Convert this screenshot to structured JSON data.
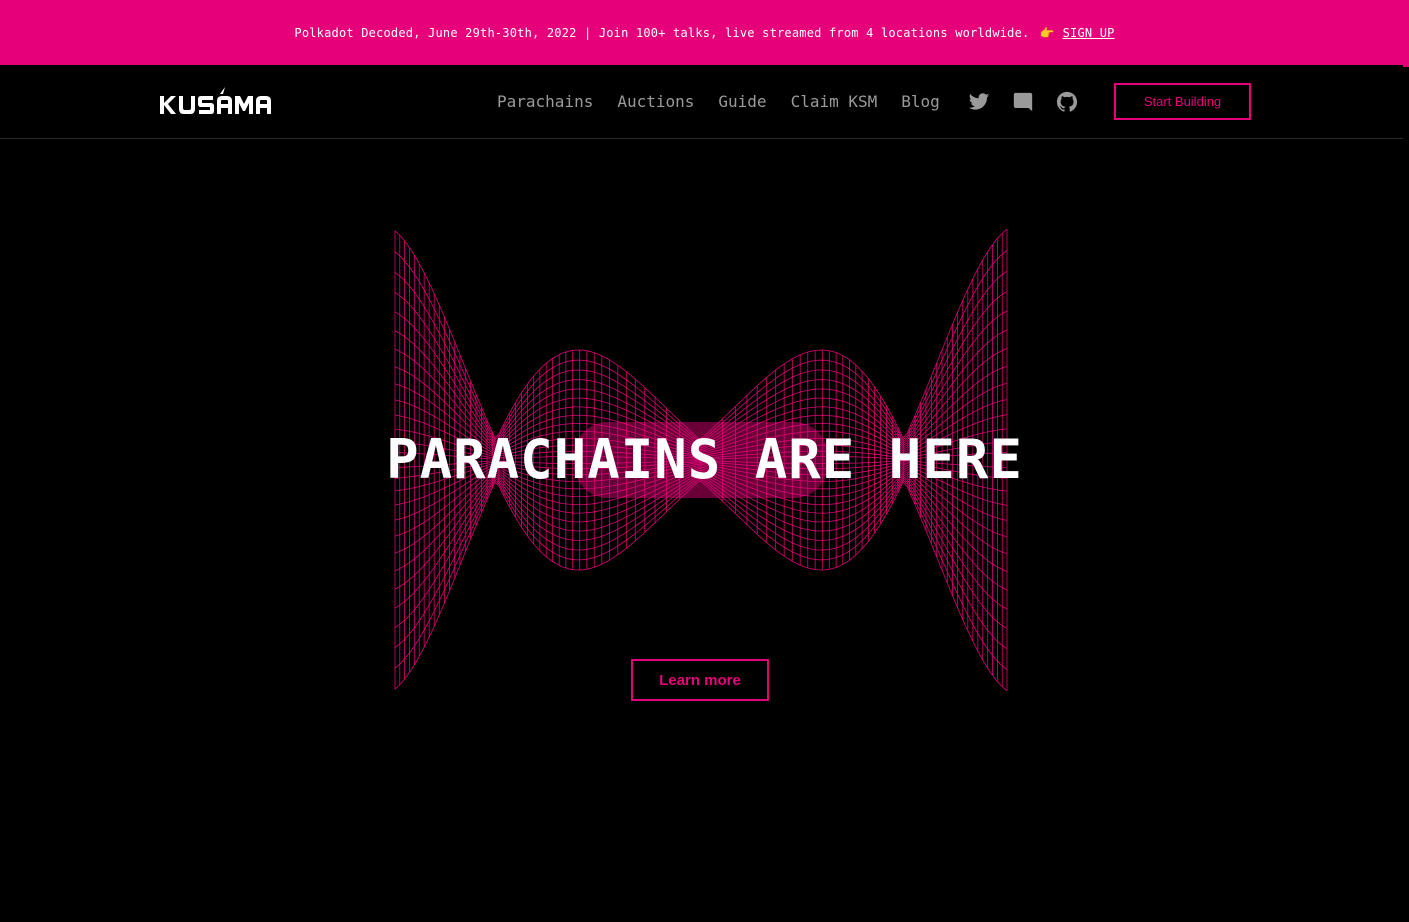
{
  "banner": {
    "message": "Polkadot Decoded, June 29th-30th, 2022 | Join 100+ talks, live streamed from 4 locations worldwide.",
    "emoji": "👉",
    "link_label": "SIGN UP"
  },
  "brand": {
    "logo_text": "KUSAMA",
    "accent": "#e6007a"
  },
  "nav": {
    "items": [
      {
        "label": "Parachains"
      },
      {
        "label": "Auctions"
      },
      {
        "label": "Guide"
      },
      {
        "label": "Claim KSM"
      },
      {
        "label": "Blog"
      }
    ],
    "social": [
      "twitter-icon",
      "discord-icon",
      "github-icon"
    ],
    "cta_label": "Start Building"
  },
  "hero": {
    "title": "PARACHAINS ARE HERE",
    "button_label": "Learn more"
  }
}
